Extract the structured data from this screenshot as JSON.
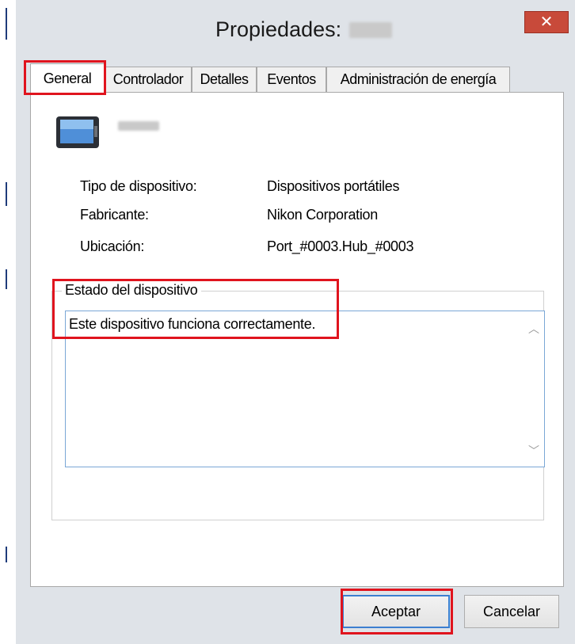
{
  "window": {
    "title": "Propiedades:"
  },
  "tabs": [
    {
      "label": "General"
    },
    {
      "label": "Controlador"
    },
    {
      "label": "Detalles"
    },
    {
      "label": "Eventos"
    },
    {
      "label": "Administración de energía"
    }
  ],
  "properties": [
    {
      "label": "Tipo de dispositivo:",
      "value": "Dispositivos portátiles"
    },
    {
      "label": "Fabricante:",
      "value": "Nikon Corporation"
    },
    {
      "label": "Ubicación:",
      "value": "Port_#0003.Hub_#0003"
    }
  ],
  "status": {
    "legend": "Estado del dispositivo",
    "text": "Este dispositivo funciona correctamente."
  },
  "buttons": {
    "ok": "Aceptar",
    "cancel": "Cancelar"
  },
  "colors": {
    "highlight": "#e0141e",
    "close": "#c84a3a",
    "focus": "#3c7fd0"
  }
}
